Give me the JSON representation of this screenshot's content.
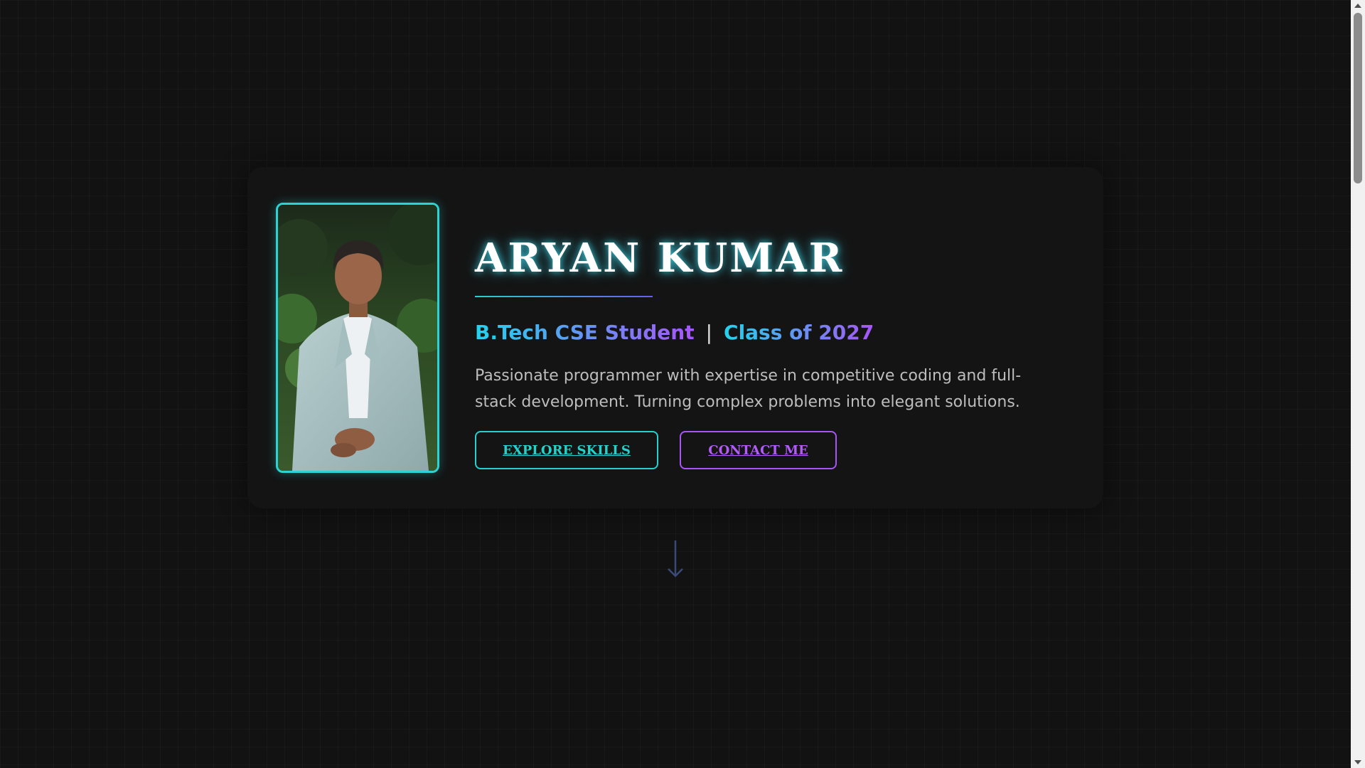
{
  "profile": {
    "name": "ARYAN KUMAR",
    "degree": "B.Tech CSE Student",
    "separator": "|",
    "class_of": "Class of 2027",
    "description": "Passionate programmer with expertise in competitive coding and full-stack development. Turning complex problems into elegant solutions.",
    "photo_icon": "profile-photo"
  },
  "actions": {
    "explore_label": "EXPLORE SKILLS",
    "contact_label": "CONTACT ME"
  },
  "icons": {
    "scroll": "arrow-down-icon"
  },
  "colors": {
    "background": "#121212",
    "card": "#141414",
    "accent_cyan": "#26d0ce",
    "accent_purple": "#a855f7",
    "text_muted": "#bdbdbd"
  }
}
